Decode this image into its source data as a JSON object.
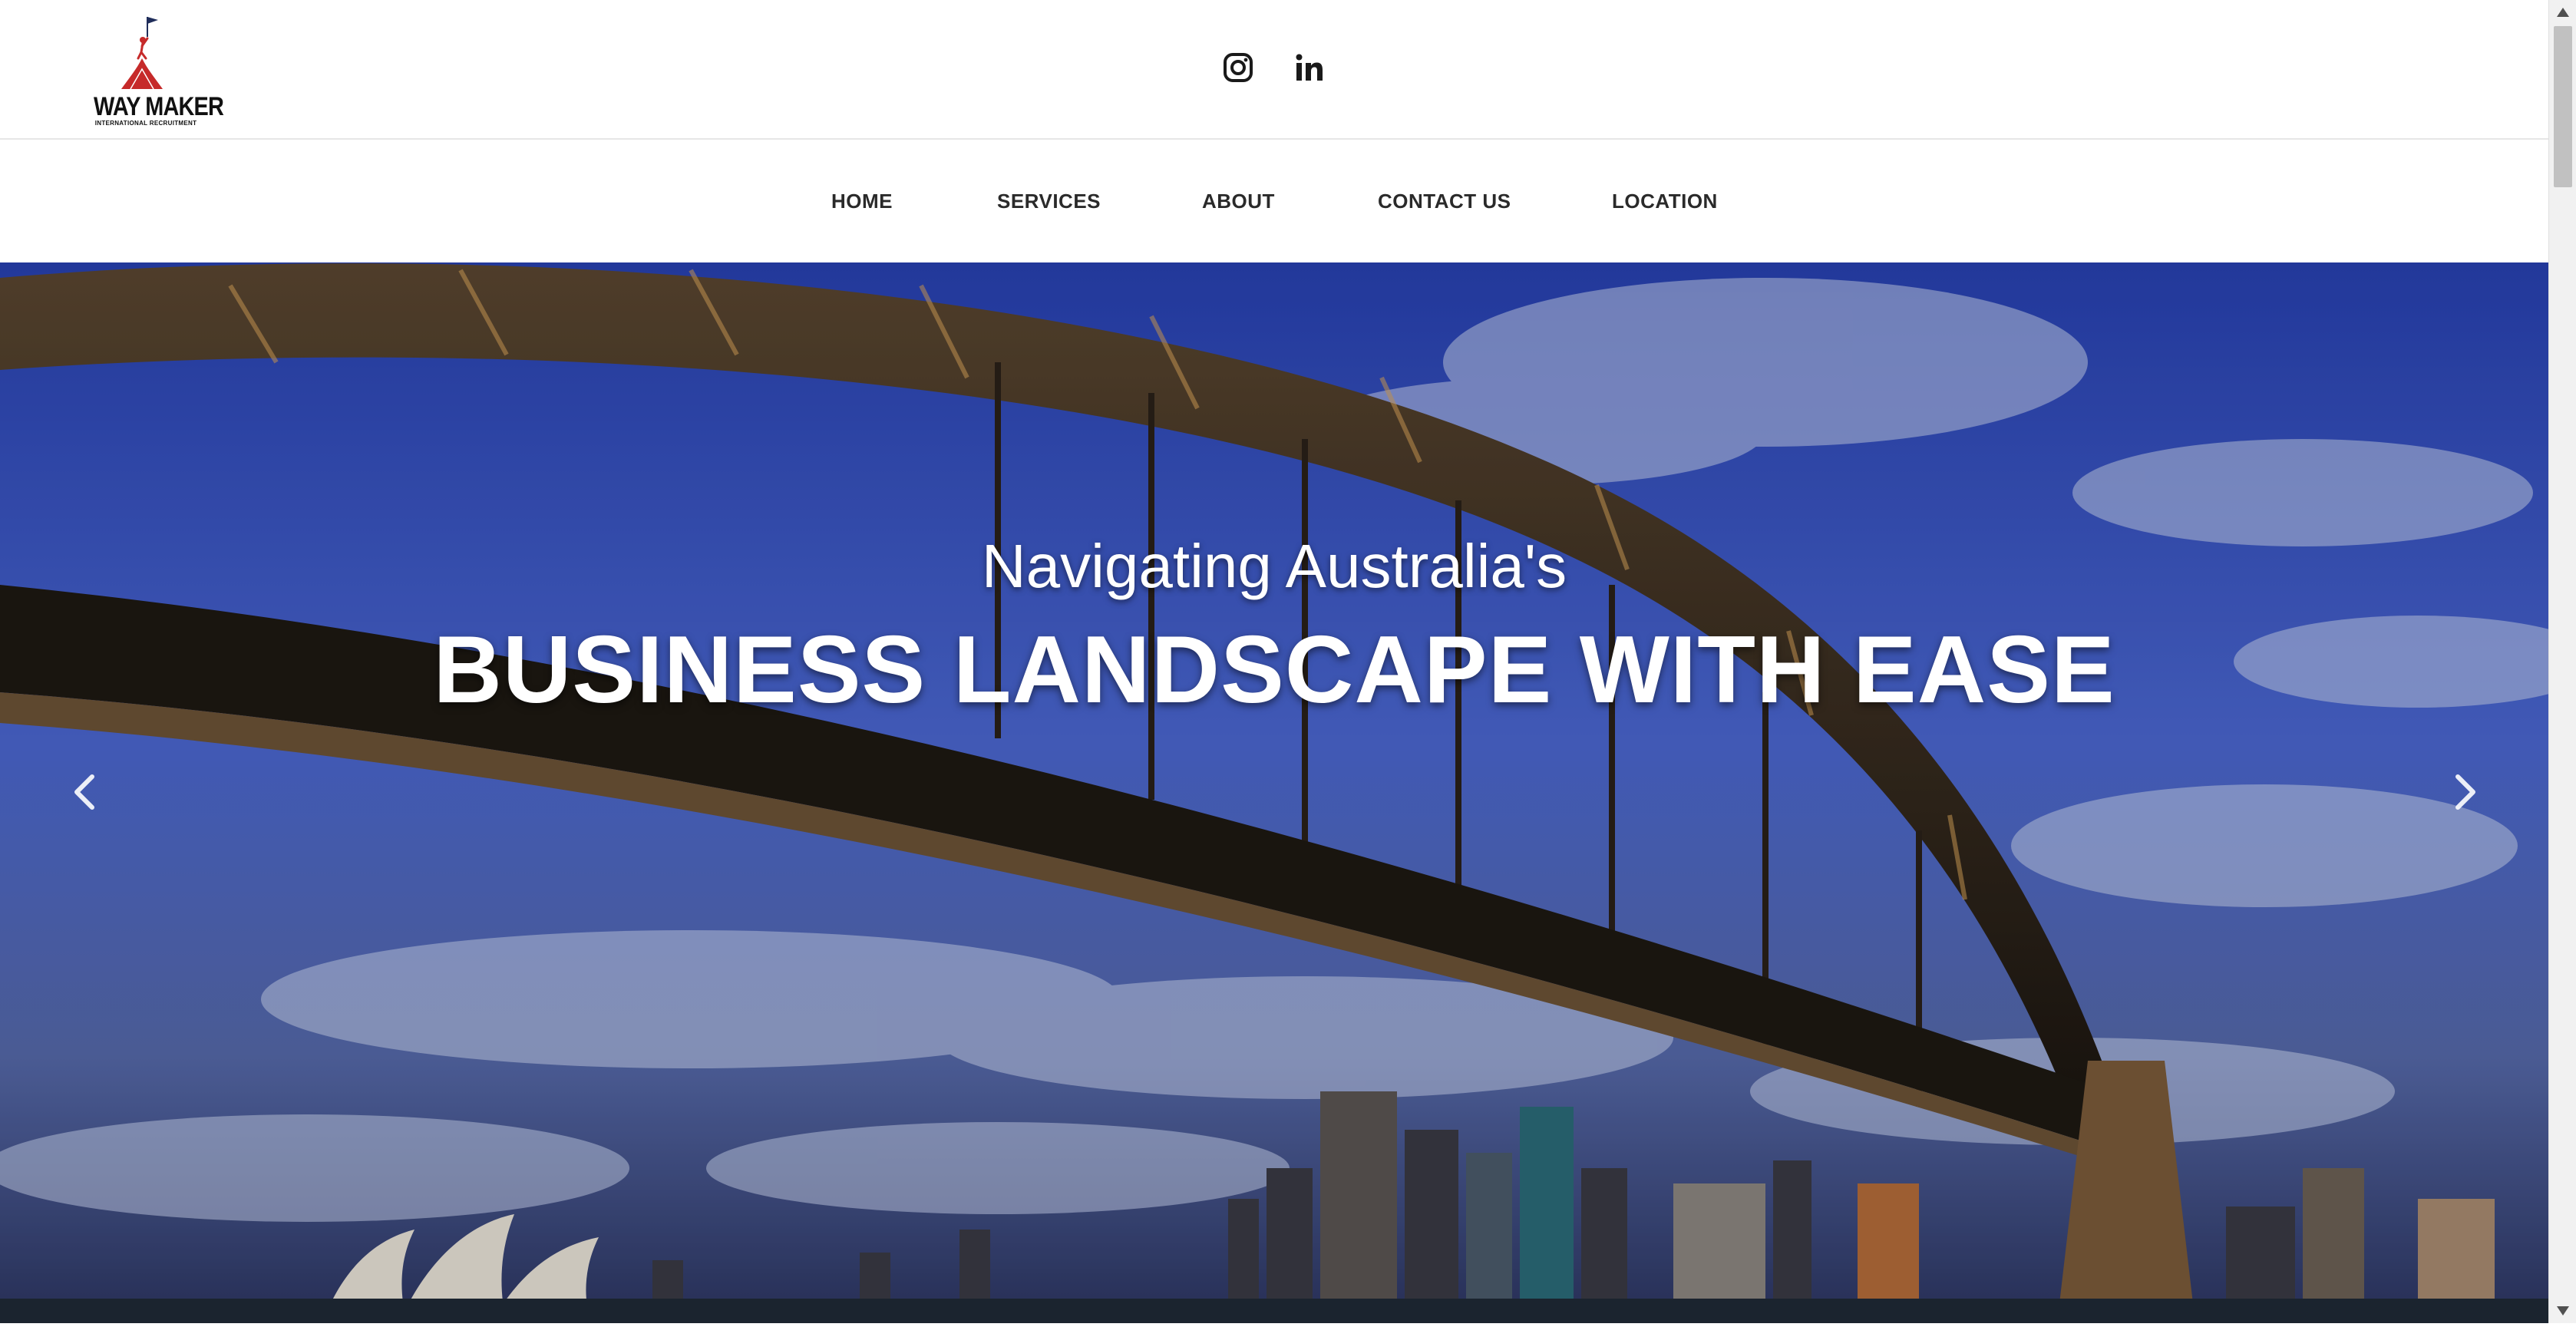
{
  "header": {
    "logo": {
      "title": "WAY MAKER",
      "subtitle": "INTERNATIONAL RECRUITMENT"
    },
    "social": [
      {
        "name": "instagram-icon"
      },
      {
        "name": "linkedin-icon"
      }
    ]
  },
  "nav": {
    "items": [
      {
        "label": "HOME"
      },
      {
        "label": "SERVICES"
      },
      {
        "label": "ABOUT"
      },
      {
        "label": "CONTACT US"
      },
      {
        "label": "LOCATION"
      }
    ]
  },
  "hero": {
    "subtitle": "Navigating Australia's",
    "title": "BUSINESS LANDSCAPE WITH EASE",
    "prev_icon": "chevron-left-icon",
    "next_icon": "chevron-right-icon"
  },
  "colors": {
    "logo_red": "#c62a2a",
    "logo_navy": "#1f2d5a",
    "nav_text": "#2a2a2a",
    "sky_blue": "#2d46b8"
  }
}
